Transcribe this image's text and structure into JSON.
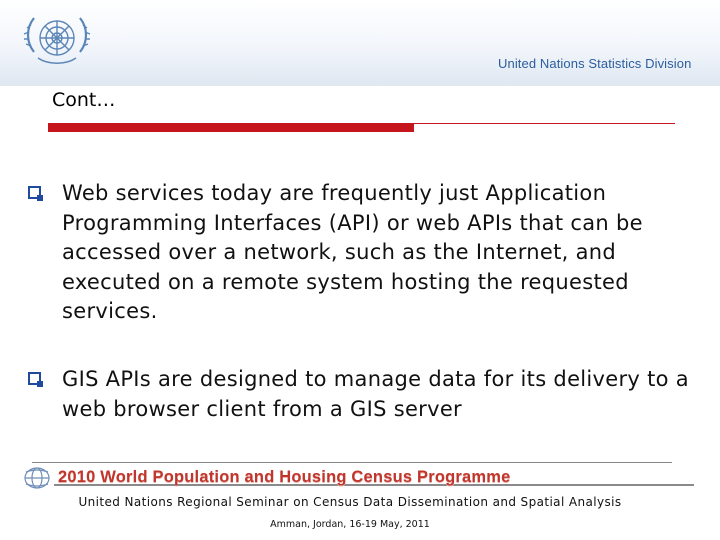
{
  "header": {
    "division": "United Nations Statistics Division",
    "emblem_icon": "un-emblem-icon",
    "colors": {
      "brand_blue": "#2c5d9e",
      "accent_red": "#c4161c"
    }
  },
  "slide": {
    "title": "Cont…",
    "bullets": [
      {
        "text": "Web services today are frequently just Application Programming Interfaces (API) or web APIs that can be accessed over a network, such as the Internet, and executed on a remote system hosting the requested services."
      },
      {
        "text": "GIS APIs are designed to manage data for its delivery to a web browser client from a GIS server"
      }
    ]
  },
  "footer": {
    "banner": "2010 World Population and Housing Census Programme",
    "banner_icon": "globe-logo-icon",
    "seminar": "United Nations Regional Seminar on Census Data Dissemination and Spatial Analysis",
    "place": "Amman, Jordan, 16-19 May, 2011"
  }
}
